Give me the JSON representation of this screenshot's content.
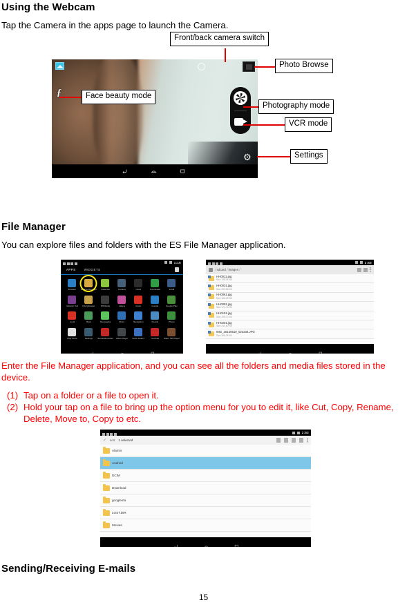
{
  "document": {
    "page_number": "15"
  },
  "sections": {
    "webcam": {
      "heading": "Using the Webcam",
      "intro": "Tap the Camera in the apps page to launch the Camera.",
      "callouts": [
        {
          "id": "front-back",
          "label": "Front/back camera switch"
        },
        {
          "id": "photo-browse",
          "label": "Photo Browse"
        },
        {
          "id": "face-beauty",
          "label": "Face beauty mode"
        },
        {
          "id": "photography-mode",
          "label": "Photography mode"
        },
        {
          "id": "vcr-mode",
          "label": "VCR mode"
        },
        {
          "id": "settings",
          "label": "Settings"
        }
      ]
    },
    "file_manager": {
      "heading": "File Manager",
      "intro": "You can explore files and folders with the ES File Manager application.",
      "body": "Enter the File Manager application, and you can see all the folders and media files stored in the device.",
      "steps": [
        {
          "marker": "(1)",
          "text": "Tap on a folder or a file to open it."
        },
        {
          "marker": "(2)",
          "text": "Hold your tap on a file to bring up the option menu for you to edit it, like Cut, Copy, Rename, Delete, Move to, Copy to etc."
        }
      ]
    },
    "email": {
      "heading": "Sending/Receiving E-mails"
    }
  },
  "apps_screenshot": {
    "tabs": [
      {
        "label": "APPS",
        "active": true
      },
      {
        "label": "WIDGETS",
        "active": false
      }
    ],
    "status_time": "1:15",
    "apps": [
      {
        "label": "Browser",
        "color": "#2b7fc4"
      },
      {
        "label": "ES File Manager",
        "color": "#d8a93f",
        "highlighted": true
      },
      {
        "label": "Calendar",
        "color": "#8cc63f"
      },
      {
        "label": "Camera",
        "color": "#46607a"
      },
      {
        "label": "Clock",
        "color": "#2b2b2b"
      },
      {
        "label": "Downloads",
        "color": "#2f9e44"
      },
      {
        "label": "Email",
        "color": "#3b5b88"
      },
      {
        "label": "Network Test",
        "color": "#7a3f8f"
      },
      {
        "label": "File Manager",
        "color": "#c9a24d"
      },
      {
        "label": "FM Radio",
        "color": "#3c3c3c"
      },
      {
        "label": "Gallery",
        "color": "#c0519a"
      },
      {
        "label": "Gmail",
        "color": "#d93025"
      },
      {
        "label": "Google",
        "color": "#2b7fc4"
      },
      {
        "label": "Google Play",
        "color": "#4a8f3c"
      },
      {
        "label": "Local",
        "color": "#d93025"
      },
      {
        "label": "Maps",
        "color": "#4a9a5a"
      },
      {
        "label": "Messaging",
        "color": "#5ec45e"
      },
      {
        "label": "Music",
        "color": "#2f6fb5"
      },
      {
        "label": "Navigation",
        "color": "#3f7fd0"
      },
      {
        "label": "People",
        "color": "#4a8ac0"
      },
      {
        "label": "Phone",
        "color": "#3c8f3c"
      },
      {
        "label": "Play Store",
        "color": "#e0e0e0"
      },
      {
        "label": "Settings",
        "color": "#3a5a72"
      },
      {
        "label": "Sound Recorder",
        "color": "#c62828"
      },
      {
        "label": "Video Player",
        "color": "#44474a"
      },
      {
        "label": "Voice Search",
        "color": "#3b6fc0"
      },
      {
        "label": "YouTube",
        "color": "#c62828"
      },
      {
        "label": "Super HD Player",
        "color": "#7a4f2f"
      }
    ]
  },
  "files_screenshot": {
    "breadcrumbs": [
      "sdcard",
      "Images"
    ],
    "status_time": "2:53",
    "files": [
      {
        "name": "HH0011.jpg",
        "size": "Size 138.04 KB"
      },
      {
        "name": "HH0031.jpg",
        "size": "Size 203.98 KB"
      },
      {
        "name": "HH0061.jpg",
        "size": "Size 186.40 KB"
      },
      {
        "name": "HH0091.jpg",
        "size": "Size 171.76 KB"
      },
      {
        "name": "HH0191.jpg",
        "size": "Size 195.72 KB"
      },
      {
        "name": "HH0201.jpg",
        "size": "Size 240.60 KB"
      },
      {
        "name": "IMG_20130510_023334.JPG",
        "size": "Size 266.28 KB"
      }
    ]
  },
  "folders_screenshot": {
    "selection_label": "1 selected",
    "status_time": "2:53",
    "toolbar": [
      {
        "name": "share-icon"
      },
      {
        "name": "copy-icon"
      },
      {
        "name": "delete-icon"
      },
      {
        "name": "cut-icon"
      },
      {
        "name": "more-icon"
      }
    ],
    "folders": [
      {
        "name": "Alarms",
        "selected": false
      },
      {
        "name": "Android",
        "selected": true
      },
      {
        "name": "DCIM",
        "selected": false
      },
      {
        "name": "Download",
        "selected": false
      },
      {
        "name": "googleota",
        "selected": false
      },
      {
        "name": "LOST.DIR",
        "selected": false
      },
      {
        "name": "Movies",
        "selected": false
      }
    ]
  },
  "colors": {
    "leader_line": "#e00000",
    "highlight_ring": "#f5e519",
    "body_red": "#ff0000",
    "selection_blue": "#7fc7e8"
  }
}
